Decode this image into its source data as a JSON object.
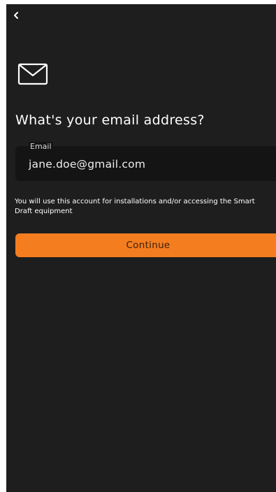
{
  "header": {
    "back_icon": "chevron-left-icon"
  },
  "hero": {
    "icon": "envelope-icon",
    "title": "What's your email address?"
  },
  "email_field": {
    "label": "Email",
    "value": "jane.doe@gmail.com"
  },
  "helper_text": "You will use this account for installations and/or accessing the Smart Draft equipment",
  "continue_button": {
    "label": "Continue"
  },
  "colors": {
    "background": "#1e1e1e",
    "field_background": "#141414",
    "accent": "#f47d20",
    "text": "#ffffff"
  }
}
